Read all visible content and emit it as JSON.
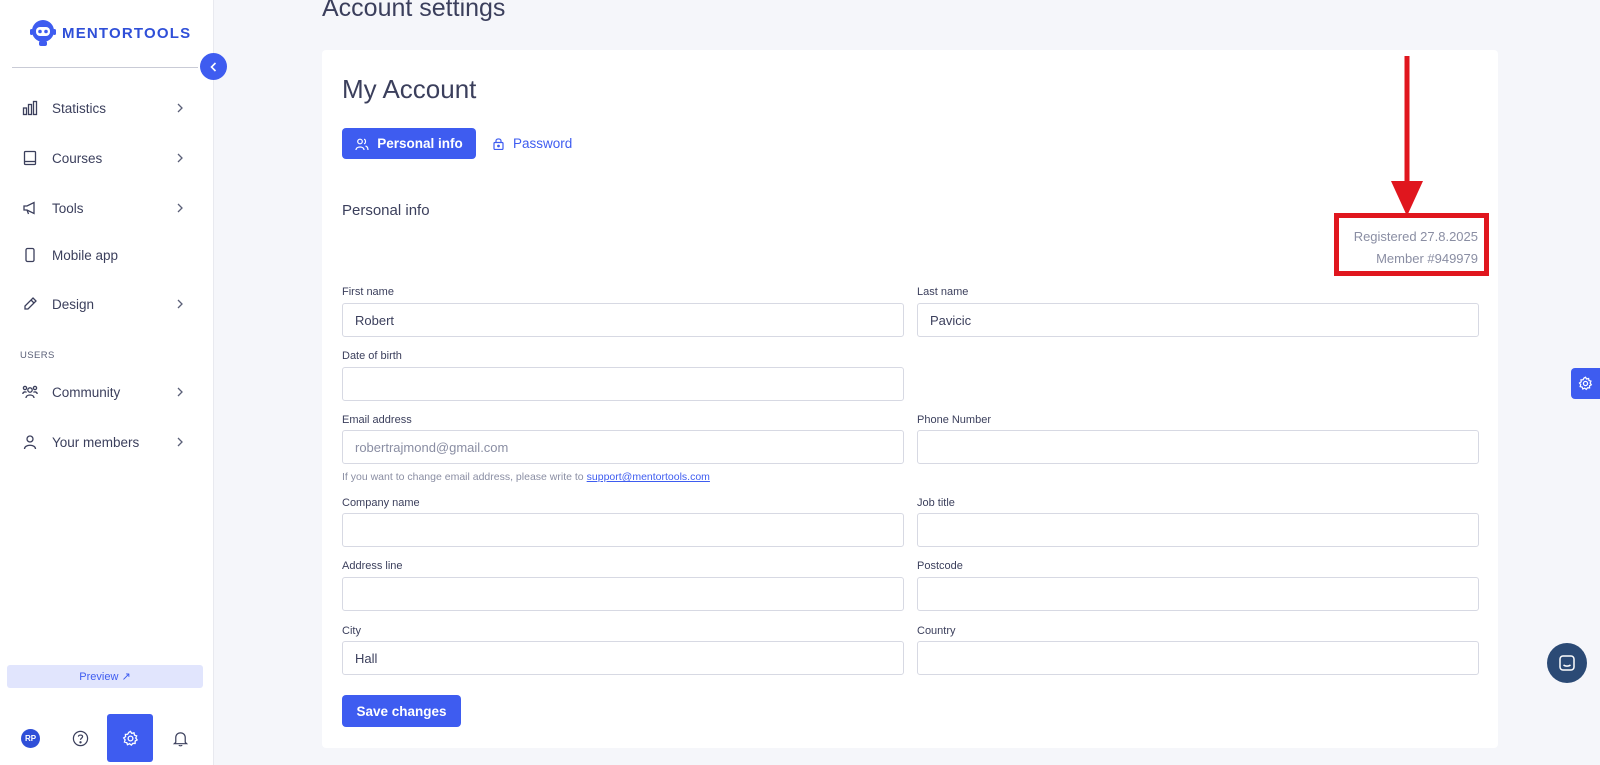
{
  "app": {
    "brand": "MENTORTOOLS",
    "accent_color": "#3e5cf0",
    "annotation_color": "#e0161e"
  },
  "sidebar": {
    "items": [
      {
        "label": "Statistics",
        "icon": "bar-chart-icon",
        "has_chevron": true
      },
      {
        "label": "Courses",
        "icon": "book-icon",
        "has_chevron": true
      },
      {
        "label": "Tools",
        "icon": "megaphone-icon",
        "has_chevron": true
      },
      {
        "label": "Mobile app",
        "icon": "mobile-icon",
        "has_chevron": false
      },
      {
        "label": "Design",
        "icon": "pencil-icon",
        "has_chevron": true
      }
    ],
    "section_users": "USERS",
    "user_items": [
      {
        "label": "Community",
        "icon": "community-icon",
        "has_chevron": true
      },
      {
        "label": "Your members",
        "icon": "user-icon",
        "has_chevron": true
      }
    ],
    "preview_label": "Preview ↗",
    "avatar_initials": "RP"
  },
  "main": {
    "page_heading": "Account settings",
    "card_title": "My Account",
    "tabs": [
      {
        "label": "Personal info",
        "active": true,
        "icon": "users-icon"
      },
      {
        "label": "Password",
        "active": false,
        "icon": "lock-icon"
      }
    ],
    "section_title": "Personal info",
    "registered": "Registered 27.8.2025",
    "member": "Member #949979",
    "fields": {
      "first_name": {
        "label": "First name",
        "value": "Robert"
      },
      "last_name": {
        "label": "Last name",
        "value": "Pavicic"
      },
      "dob": {
        "label": "Date of birth",
        "value": ""
      },
      "email": {
        "label": "Email address",
        "value": "robertrajmond@gmail.com"
      },
      "phone": {
        "label": "Phone Number",
        "value": ""
      },
      "company": {
        "label": "Company name",
        "value": ""
      },
      "job": {
        "label": "Job title",
        "value": ""
      },
      "address": {
        "label": "Address line",
        "value": ""
      },
      "postcode": {
        "label": "Postcode",
        "value": ""
      },
      "city": {
        "label": "City",
        "value": "Hall"
      },
      "country": {
        "label": "Country",
        "value": ""
      }
    },
    "email_hint": "If you want to change email address, please write to",
    "support_email": "support@mentortools.com",
    "save_label": "Save changes"
  }
}
